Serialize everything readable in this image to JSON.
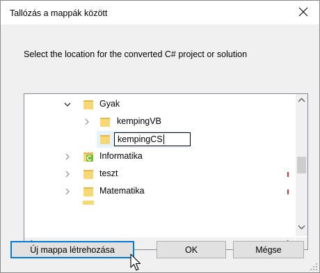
{
  "window": {
    "title": "Tallózás a mappák között",
    "close_icon": "close-icon"
  },
  "instruction": "Select the location for the converted C# project or solution",
  "tree": {
    "items": [
      {
        "label": "Gyak",
        "expanded": true
      },
      {
        "label": "kempingVB",
        "expanded": false
      },
      {
        "label": "kempingCS",
        "editing": true
      },
      {
        "label": "Informatika",
        "expanded": false,
        "icon": "vs-folder-icon"
      },
      {
        "label": "teszt",
        "expanded": false
      },
      {
        "label": "Matematika",
        "expanded": false
      }
    ]
  },
  "buttons": {
    "new_folder": "Új mappa létrehozása",
    "ok": "OK",
    "cancel": "Mégse"
  },
  "colors": {
    "accent": "#0078d7",
    "folder": "#f8d775",
    "folder_dark": "#e6b84a",
    "dialog_bg": "#f0f0f0",
    "vs_green": "#6dbb2a"
  }
}
